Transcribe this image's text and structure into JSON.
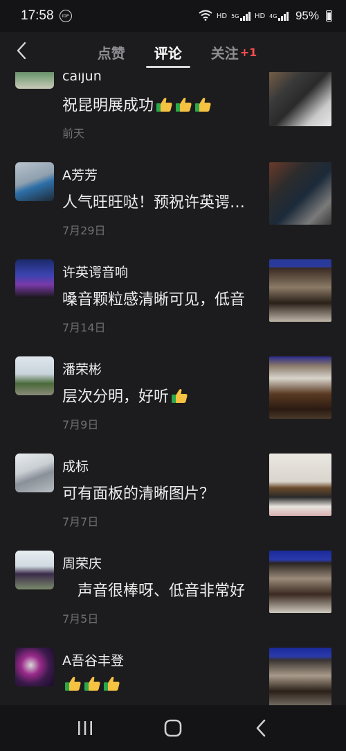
{
  "status": {
    "time": "17:58",
    "notif_badge": "IDP",
    "net1": "HD",
    "net2": "5G",
    "net3": "HD",
    "net4": "4G",
    "battery": "95%"
  },
  "header": {
    "tabs": [
      {
        "label": "点赞",
        "active": false
      },
      {
        "label": "评论",
        "active": true
      },
      {
        "label": "关注",
        "active": false,
        "count": "+1"
      }
    ]
  },
  "comments": [
    {
      "name": "caijun",
      "text": "祝昆明展成功",
      "thumbs": 3,
      "date": "前天"
    },
    {
      "name": "A芳芳",
      "text": "人气旺旺哒！预祝许英谔音响",
      "thumbs": 0,
      "date": "7月29日"
    },
    {
      "name": "许英谔音响",
      "text": "嗓音颗粒感清晰可见，低音",
      "thumbs": 0,
      "date": "7月14日"
    },
    {
      "name": "潘荣彬",
      "text": "层次分明，好听",
      "thumbs": 1,
      "date": "7月9日"
    },
    {
      "name": "成标",
      "text": "可有面板的清晰图片？",
      "thumbs": 0,
      "date": "7月7日"
    },
    {
      "name": "周荣庆",
      "text": "　声音很棒呀、低音非常好",
      "thumbs": 0,
      "date": "7月5日"
    },
    {
      "name": "A吾谷丰登",
      "text": "",
      "thumbs": 3,
      "date": ""
    }
  ],
  "colors": {
    "background": "#1c1c1e",
    "accent_red": "#ff4d4f",
    "date_gray": "#6f6f74"
  }
}
